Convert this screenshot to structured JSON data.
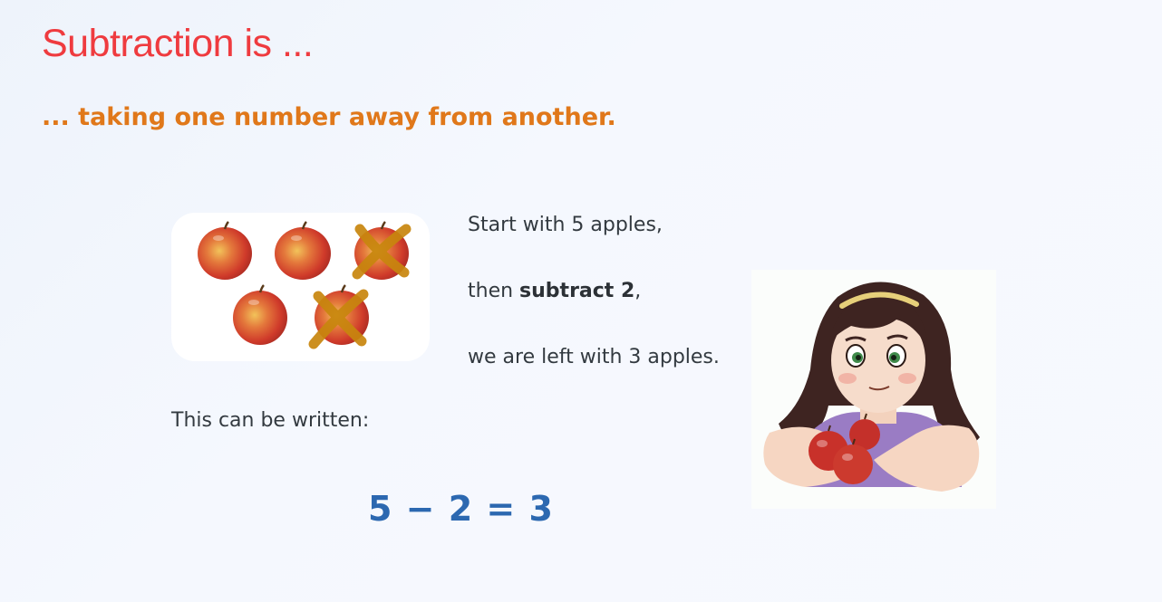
{
  "title": "Subtraction is ...",
  "subtitle": "... taking one number away from another.",
  "steps": {
    "line1": "Start with 5 apples,",
    "line2_prefix": "then ",
    "line2_bold": "subtract 2",
    "line2_suffix": ",",
    "line3": "we are left with 3 apples."
  },
  "written_label": "This can be written:",
  "equation": "5 − 2 = 3",
  "illustration": {
    "apples_total": 5,
    "apples_crossed": 2,
    "icon": "apples-crossed-out-icon",
    "girl_icon": "girl-holding-apples-icon"
  },
  "colors": {
    "title": "#ef3b3f",
    "subtitle": "#e0781a",
    "equation": "#2c68b0",
    "cross": "#c8860e",
    "text": "#333a40"
  }
}
